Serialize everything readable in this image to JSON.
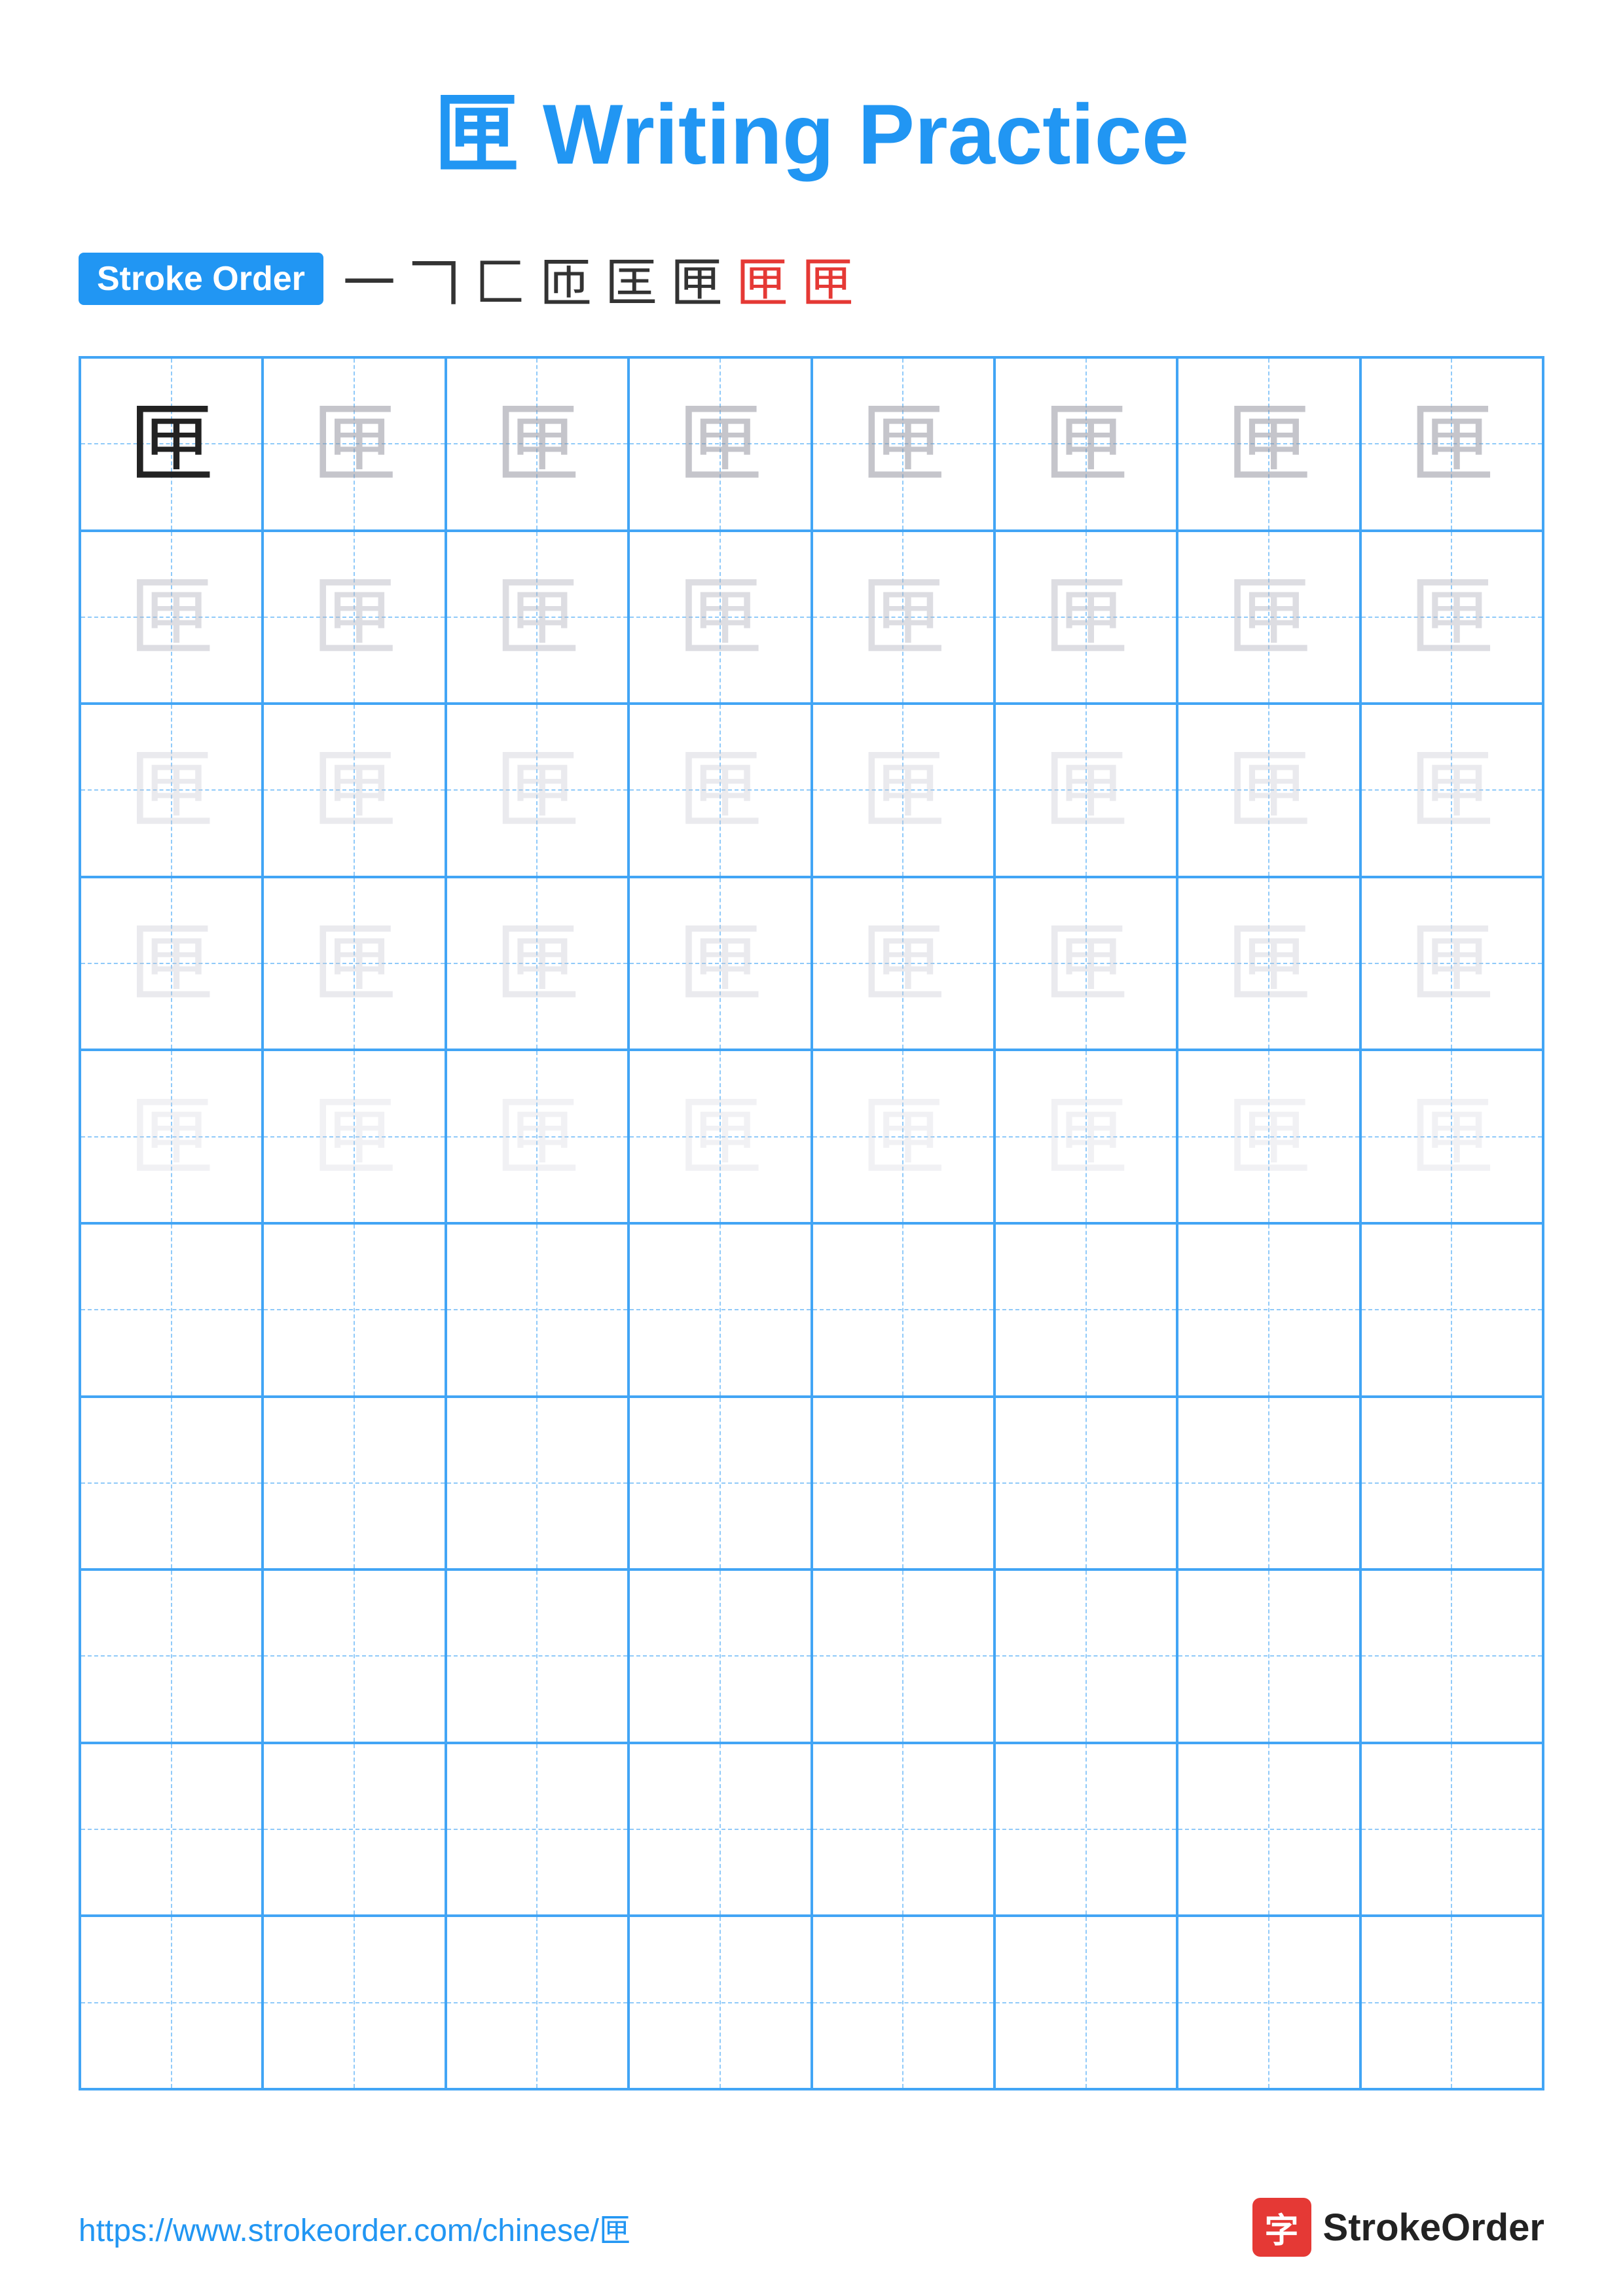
{
  "title": "匣 Writing Practice",
  "stroke_order": {
    "badge": "Stroke Order",
    "strokes": [
      "一",
      "𠃍",
      "𠃊",
      "匚",
      "匡",
      "匣",
      "匤",
      "匣"
    ]
  },
  "character": "匣",
  "grid": {
    "cols": 8,
    "rows": 10,
    "practice_rows": 5
  },
  "footer": {
    "url": "https://www.strokeorder.com/chinese/匣",
    "logo_icon": "字",
    "logo_text": "StrokeOrder"
  }
}
